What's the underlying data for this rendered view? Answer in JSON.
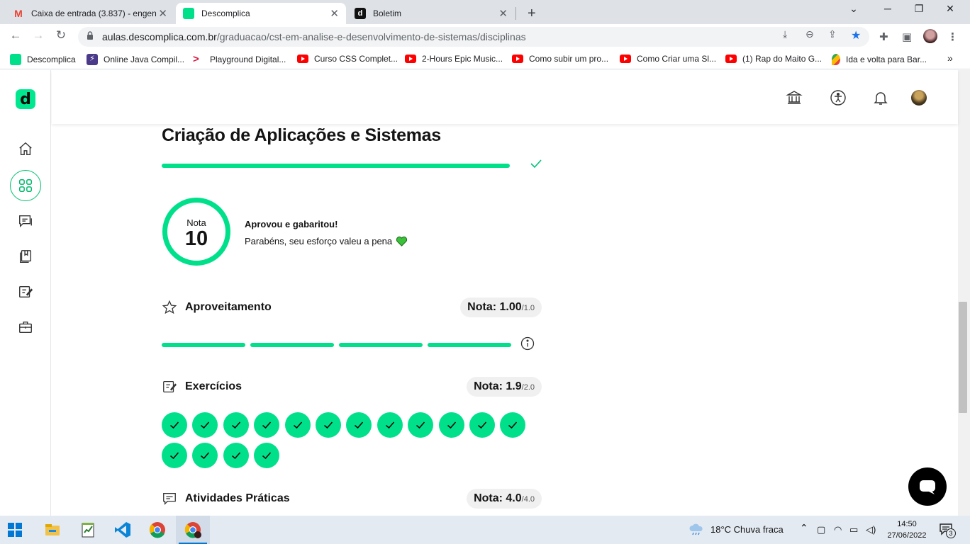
{
  "browser": {
    "tabs": [
      {
        "title": "Caixa de entrada (3.837) - engen",
        "icon": "gmail-icon",
        "active": false
      },
      {
        "title": "Descomplica",
        "icon": "descomplica-icon",
        "active": true
      },
      {
        "title": "Boletim",
        "icon": "descomplica-d-icon",
        "active": false
      }
    ],
    "new_tab": "+",
    "url": {
      "host": "aulas.descomplica.com.br",
      "path": "/graduacao/cst-em-analise-e-desenvolvimento-de-sistemas/disciplinas"
    },
    "bookmarks": [
      {
        "label": "Descomplica",
        "icon": "descomplica-icon"
      },
      {
        "label": "Online Java Compil...",
        "icon": "bolt-icon"
      },
      {
        "label": "Playground Digital...",
        "icon": "chevron-icon"
      },
      {
        "label": "Curso CSS Complet...",
        "icon": "youtube-icon"
      },
      {
        "label": "2-Hours Epic Music...",
        "icon": "youtube-icon"
      },
      {
        "label": "Como subir um pro...",
        "icon": "youtube-icon"
      },
      {
        "label": "Como Criar uma Sl...",
        "icon": "youtube-icon"
      },
      {
        "label": "(1) Rap do Maito G...",
        "icon": "youtube-icon"
      },
      {
        "label": "Ida e volta para Bar...",
        "icon": "maps-icon"
      }
    ],
    "bookmarks_more": "»"
  },
  "app": {
    "logo_letter": "d",
    "colors": {
      "accent": "#00e08a",
      "text": "#141414"
    }
  },
  "course": {
    "title": "Criação de Aplicações e Sistemas",
    "progress_fraction": 1.0,
    "grade_label": "Nota",
    "grade_value": "10",
    "message_title": "Aprovou e gabaritou!",
    "message_sub": "Parabéns, seu esforço valeu a pena"
  },
  "sections": {
    "aproveitamento": {
      "title": "Aproveitamento",
      "nota_label": "Nota: 1.00",
      "nota_max": "/1.0",
      "segments_completed": 4,
      "segments_total": 4
    },
    "exercicios": {
      "title": "Exercícios",
      "nota_label": "Nota: 1.9",
      "nota_max": "/2.0",
      "completed_count": 16
    },
    "atividades": {
      "title": "Atividades Práticas",
      "nota_label": "Nota: 4.0",
      "nota_max": "/4.0"
    }
  },
  "taskbar": {
    "weather": "18°C  Chuva fraca",
    "time": "14:50",
    "date": "27/06/2022",
    "notifications": "3"
  }
}
